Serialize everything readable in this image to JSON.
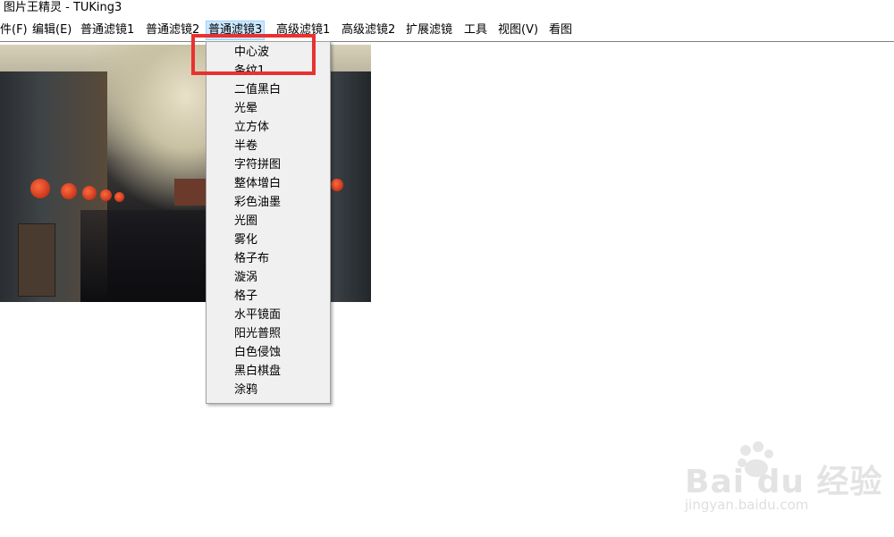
{
  "window": {
    "title": "图片王精灵 - TUKing3"
  },
  "menubar": {
    "items": [
      {
        "label": "件(F)"
      },
      {
        "label": "编辑(E)"
      },
      {
        "label": "普通滤镜1"
      },
      {
        "label": "普通滤镜2"
      },
      {
        "label": "普通滤镜3"
      },
      {
        "label": "高级滤镜1"
      },
      {
        "label": "高级滤镜2"
      },
      {
        "label": "扩展滤镜"
      },
      {
        "label": "工具"
      },
      {
        "label": "视图(V)"
      },
      {
        "label": "看图"
      }
    ],
    "active_item": "普通滤镜3"
  },
  "dropdown": {
    "items": [
      {
        "label": "中心波"
      },
      {
        "label": "条纹1"
      },
      {
        "label": "二值黑白"
      },
      {
        "label": "光晕"
      },
      {
        "label": "立方体"
      },
      {
        "label": "半卷"
      },
      {
        "label": "字符拼图"
      },
      {
        "label": "整体增白"
      },
      {
        "label": "彩色油墨"
      },
      {
        "label": "光圈"
      },
      {
        "label": "雾化"
      },
      {
        "label": "格子布"
      },
      {
        "label": "漩涡"
      },
      {
        "label": "格子"
      },
      {
        "label": "水平镜面"
      },
      {
        "label": "阳光普照"
      },
      {
        "label": "白色侵蚀"
      },
      {
        "label": "黑白棋盘"
      },
      {
        "label": "涂鸦"
      }
    ]
  },
  "watermark": {
    "text": "Bai du 经验",
    "subtext": "jingyan.baidu.com"
  },
  "colors": {
    "highlight_box": "#e8322f",
    "active_menu_bg": "#cce8ff",
    "menu_bg": "#f0f0f0"
  }
}
